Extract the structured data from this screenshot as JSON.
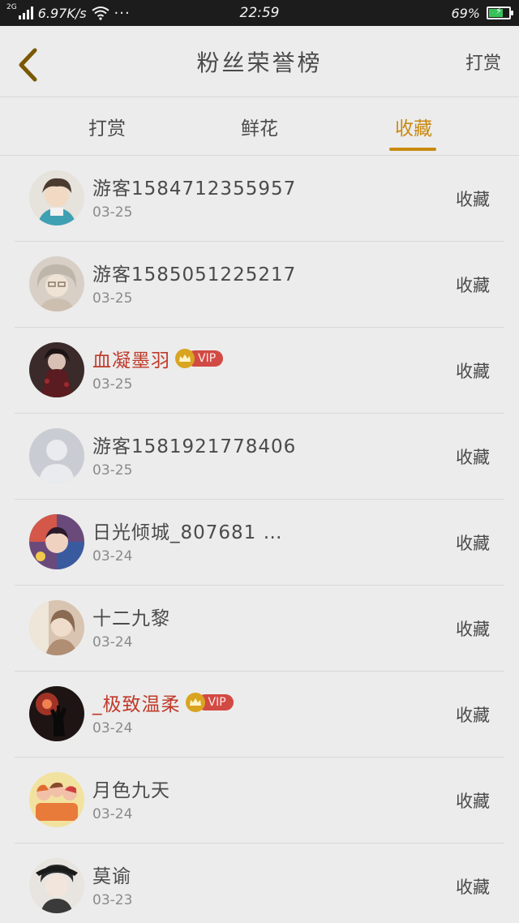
{
  "status_bar": {
    "network": "2G",
    "speed": "6.97K/s",
    "more": "···",
    "time": "22:59",
    "battery_percent": "69%",
    "battery_level": 0.69
  },
  "header": {
    "back_icon": "chevron-left-icon",
    "title": "粉丝荣誉榜",
    "action_label": "打赏"
  },
  "tabs": [
    {
      "label": "打赏",
      "active": false
    },
    {
      "label": "鲜花",
      "active": false
    },
    {
      "label": "收藏",
      "active": true
    }
  ],
  "colors": {
    "accent": "#c98a10",
    "vip_name": "#c03a2a",
    "vip_badge": "#d24a44",
    "crown": "#d9a520"
  },
  "rows": [
    {
      "name": "游客1584712355957",
      "date": "03-25",
      "action": "收藏",
      "vip": false
    },
    {
      "name": "游客1585051225217",
      "date": "03-25",
      "action": "收藏",
      "vip": false
    },
    {
      "name": "血凝墨羽",
      "date": "03-25",
      "action": "收藏",
      "vip": true,
      "vip_label": "VIP"
    },
    {
      "name": "游客1581921778406",
      "date": "03-25",
      "action": "收藏",
      "vip": false
    },
    {
      "name": "日光倾城_807681 …",
      "date": "03-24",
      "action": "收藏",
      "vip": false
    },
    {
      "name": "十二九黎",
      "date": "03-24",
      "action": "收藏",
      "vip": false
    },
    {
      "name": "_极致温柔",
      "date": "03-24",
      "action": "收藏",
      "vip": true,
      "vip_label": "VIP"
    },
    {
      "name": "月色九天",
      "date": "03-24",
      "action": "收藏",
      "vip": false
    },
    {
      "name": "莫谕",
      "date": "03-23",
      "action": "收藏",
      "vip": false
    }
  ]
}
